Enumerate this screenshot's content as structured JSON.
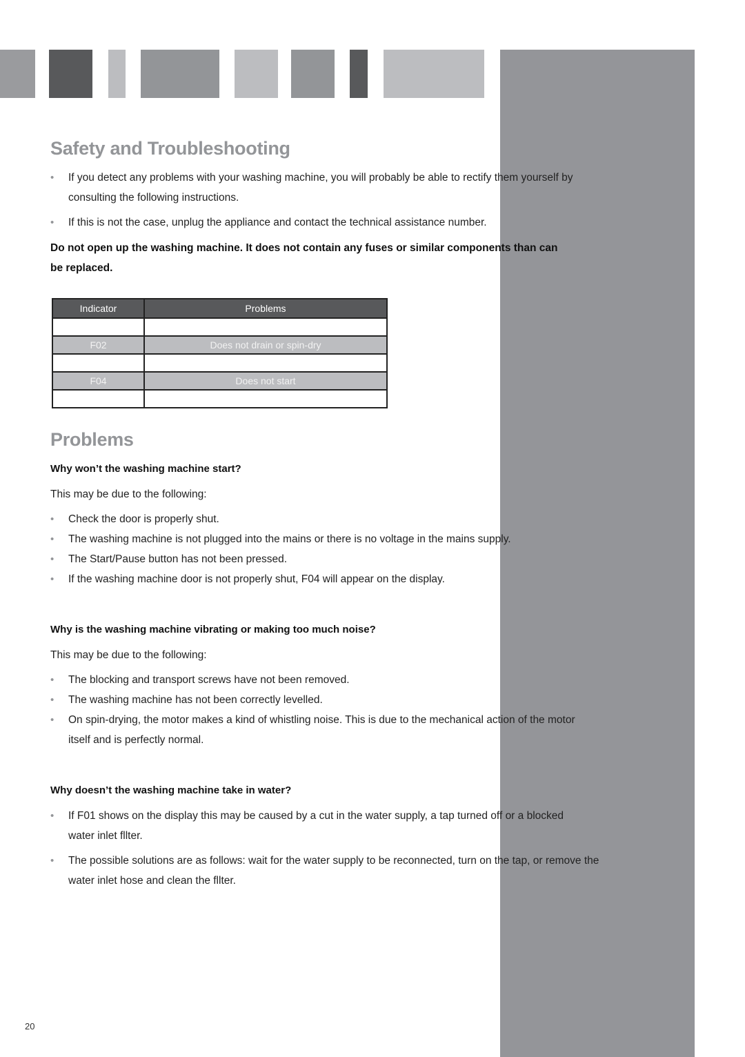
{
  "header_blocks": [
    {
      "color": "#9a9b9e"
    },
    {
      "color": "#58595b"
    },
    {
      "color": "#bcbdc0"
    },
    {
      "color": "#939598"
    },
    {
      "color": "#bcbdc0"
    },
    {
      "color": "#939598"
    },
    {
      "color": "#58595b"
    },
    {
      "color": "#bcbdc0"
    }
  ],
  "colors": {
    "title_gray": "#939598",
    "sidebar_band": "#949599",
    "table_header": "#58595b",
    "table_shaded_row": "#bcbdc0"
  },
  "safety": {
    "title": "Safety and Troubleshooting",
    "bullets": [
      {
        "line1": "If you detect any problems with your washing machine, you will probably be able to rectify them yourself by",
        "line2": "consulting the following instructions."
      },
      {
        "line1": "If this is not the case, unplug the appliance and contact the technical assistance number."
      }
    ],
    "warning_line1": "Do not open up the washing machine. It does not contain any fuses or   similar components than can",
    "warning_line2": "be replaced."
  },
  "indicator_table": {
    "headers": [
      "Indicator",
      "Problems"
    ],
    "rows": [
      {
        "indicator": "",
        "problem": ""
      },
      {
        "indicator": "F02",
        "problem": "Does not drain or spin-dry"
      },
      {
        "indicator": "",
        "problem": ""
      },
      {
        "indicator": "F04",
        "problem": "Does not start"
      },
      {
        "indicator": "",
        "problem": ""
      }
    ]
  },
  "problems": {
    "title": "Problems",
    "q1": {
      "question": "Why won’t the washing machine start?",
      "intro": "This may be due to the following:",
      "bullets": [
        "Check the door is properly shut.",
        "The washing machine is not plugged into the mains or there is no voltage in the mains supply.",
        "The Start/Pause button has not been pressed.",
        "If the washing machine door is not properly shut, F04 will appear on the display."
      ]
    },
    "q2": {
      "question": "Why is the washing machine vibrating or making too much noise?",
      "intro": "This may be due to the following:",
      "bullets": [
        {
          "line1": "The blocking and transport screws have not been removed."
        },
        {
          "line1": "The washing machine has not been correctly levelled."
        },
        {
          "line1": "On spin-drying, the motor makes a kind of whistling noise. This is due to the mechanical action of the motor",
          "line2": "itself and is perfectly normal."
        }
      ]
    },
    "q3": {
      "question": "Why doesn’t the washing machine take in water?",
      "bullets": [
        {
          "line1": "If  F01 shows on the display this may be caused by a cut in the water supply, a tap turned off or a blocked",
          "line2": "water inlet fllter."
        },
        {
          "line1": "The possible solutions are as follows: wait for the water supply to be reconnected, turn on the tap, or remove the",
          "line2": "water inlet hose and clean the fllter."
        }
      ]
    }
  },
  "bullet_glyph": "•",
  "page_number": "20"
}
